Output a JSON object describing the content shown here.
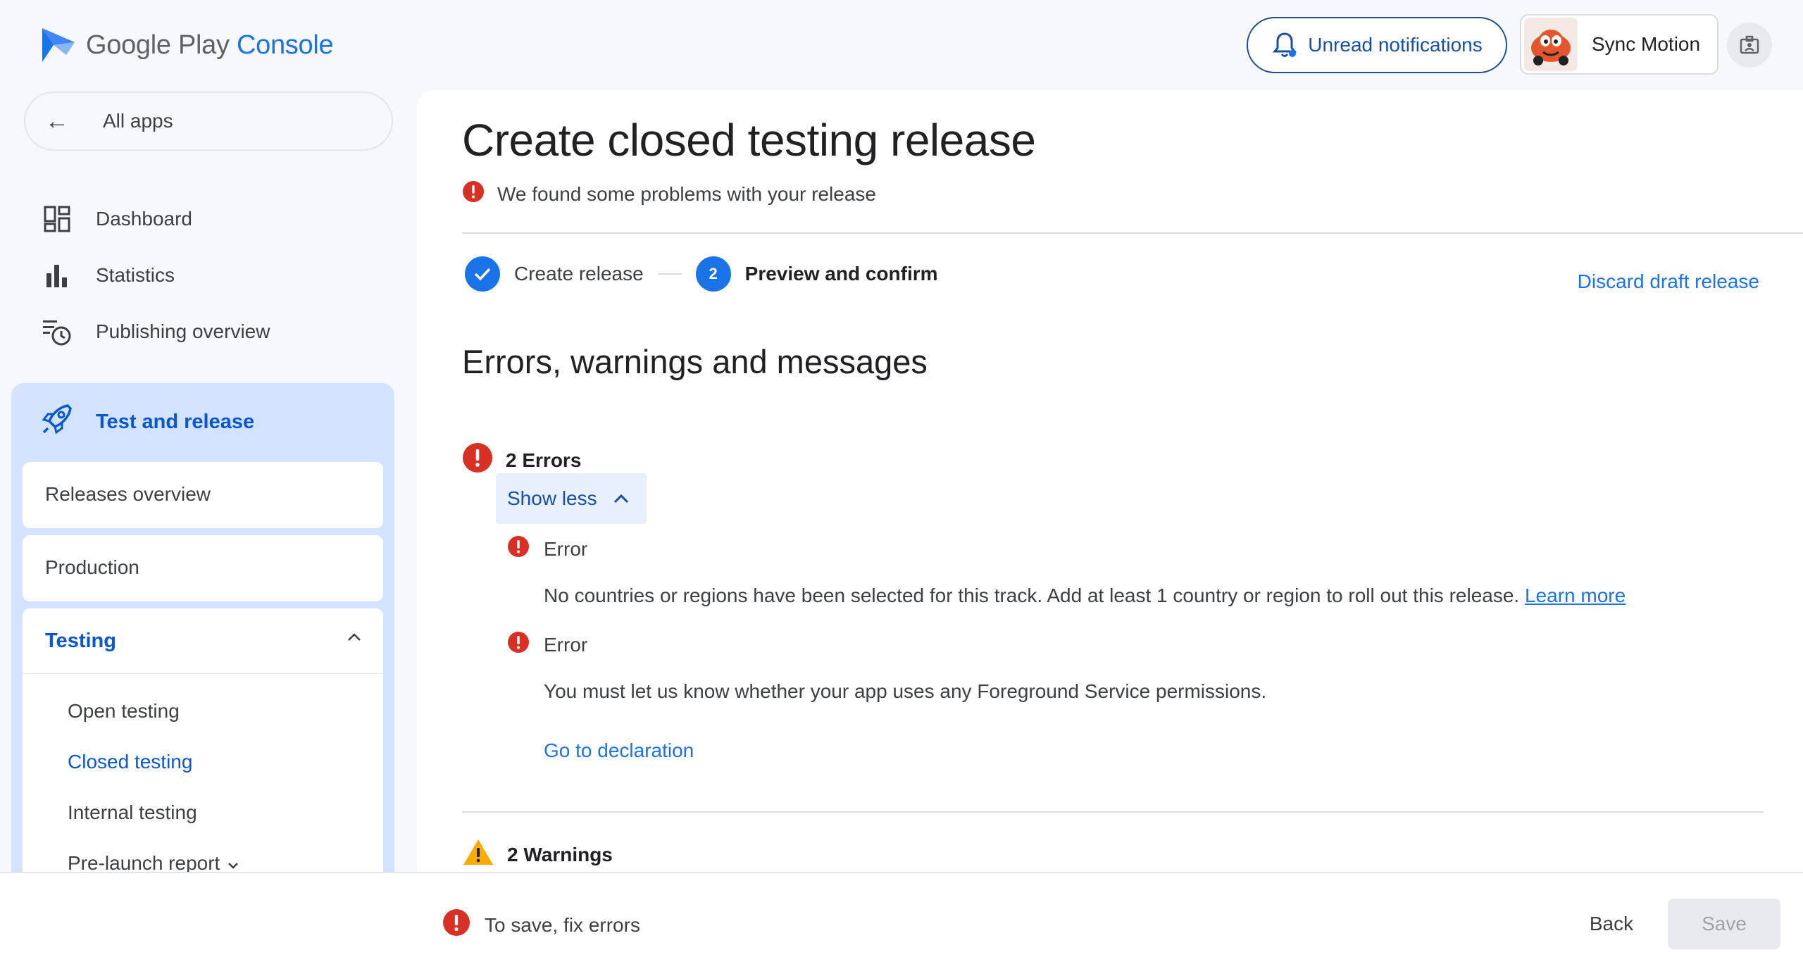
{
  "brand": {
    "google_play": "Google Play",
    "console": "Console"
  },
  "header": {
    "notifications_label": "Unread notifications",
    "account_name": "Sync Motion"
  },
  "sidebar": {
    "all_apps": "All apps",
    "items": [
      {
        "label": "Dashboard",
        "icon": "dashboard-icon"
      },
      {
        "label": "Statistics",
        "icon": "bar-chart-icon"
      },
      {
        "label": "Publishing overview",
        "icon": "publishing-history-icon"
      }
    ],
    "test_release": {
      "label": "Test and release",
      "icon": "rocket-icon",
      "releases_overview": "Releases overview",
      "production": "Production",
      "testing": {
        "label": "Testing",
        "items": [
          "Open testing",
          "Closed testing",
          "Internal testing",
          "Pre-launch report"
        ],
        "active": "Closed testing"
      }
    }
  },
  "main": {
    "title": "Create closed testing release",
    "problem_text": "We found some problems with your release",
    "stepper": {
      "step1": "Create release",
      "step2_number": "2",
      "step2": "Preview and confirm"
    },
    "discard_label": "Discard draft release",
    "section_title": "Errors, warnings and messages",
    "errors": {
      "count_label": "2 Errors",
      "toggle_label": "Show less",
      "items": [
        {
          "title": "Error",
          "message": "No countries or regions have been selected for this track. Add at least 1 country or region to roll out this release.",
          "link": "Learn more"
        },
        {
          "title": "Error",
          "message": "You must let us know whether your app uses any Foreground Service permissions.",
          "action": "Go to declaration"
        }
      ]
    },
    "warnings": {
      "count_label": "2 Warnings"
    }
  },
  "footer": {
    "message": "To save, fix errors",
    "back_label": "Back",
    "save_label": "Save"
  },
  "colors": {
    "accent": "#1a73e8",
    "error": "#d93025",
    "warning": "#f9ab00",
    "nav_active_bg": "#d3e3fd"
  }
}
